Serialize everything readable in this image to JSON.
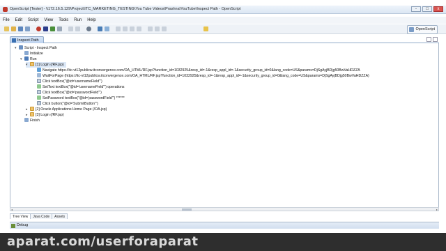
{
  "window": {
    "title": "OpenScript [Tester] - \\\\172.16.5.129\\Project\\ITC_MARKETING_TESTING\\You Tube Videos\\Prashna\\YouTube\\Inspect Path - OpenScript",
    "controls": [
      "-",
      "□",
      "x"
    ]
  },
  "menu": [
    "File",
    "Edit",
    "Script",
    "View",
    "Tools",
    "Run",
    "Help"
  ],
  "perspective": "OpenScript",
  "editor_tab": "Inspect Path",
  "tree": [
    {
      "text": "Script - Inspect Path"
    },
    {
      "text": "Initialize"
    },
    {
      "text": "Run"
    },
    {
      "text": "[1] Login (/RF.jsp)"
    },
    {
      "text": "Navigate https://itc-vt12publicw.itconvergence.com/OA_HTML/RF.jsp?function_id=1032925&resp_id=-1&resp_appl_id=-1&security_group_id=0&lang_code=US&params=DjSgAyjBDjg50BwVaHDZZA"
    },
    {
      "text": "WaitForPage (https://itc-vt12publicw.itconvergence.com/OA_HTML/RF.jsp?function_id=1032925&resp_id=-1&resp_appl_id=-1&security_group_id=0&lang_code=US&params=DjSgAyjBDjg50BwVaHDZZA)"
    },
    {
      "text": "Click textBox(\"@id='usernameField'\")"
    },
    {
      "text": "SetText textBox(\"@id='usernameField'\") operations"
    },
    {
      "text": "Click textBox(\"@id='passwordField'\")"
    },
    {
      "text": "SetPassword textBox(\"@id='passwordField'\") ******"
    },
    {
      "text": "Click button(\"@id='SubmitButton'\")"
    },
    {
      "text": "[2] Oracle Applications Home Page (/OA.jsp)"
    },
    {
      "text": "[3] Login (/RF.jsp)"
    },
    {
      "text": "Finish"
    }
  ],
  "bottom_tabs": [
    "Tree View",
    "Java Code",
    "Assets"
  ],
  "debug_tab": "Debug",
  "watermark": "aparat.com/userforaparat"
}
